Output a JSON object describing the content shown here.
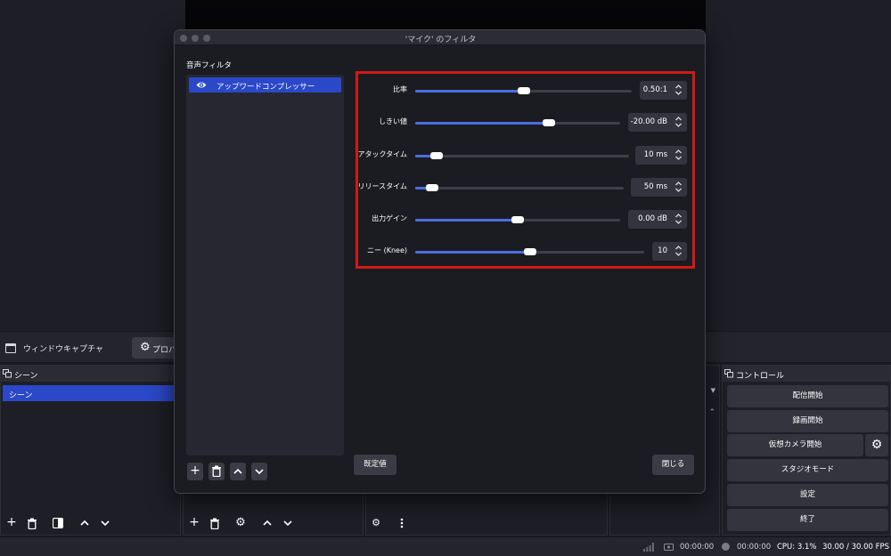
{
  "main": {
    "source_name": "ウィンドウキャプチャ",
    "properties_label": "プロパ",
    "scene_dock": {
      "title": "シーン",
      "items": [
        "シーン"
      ]
    },
    "controls_dock": {
      "title": "コントロール",
      "buttons": [
        "配信開始",
        "録画開始",
        "仮想カメラ開始",
        "スタジオモード",
        "設定",
        "終了"
      ]
    }
  },
  "status": {
    "rec_time": "00:00:00",
    "stream_time": "00:00:00",
    "cpu": "CPU: 3.1%",
    "fps": "30.00 / 30.00 FPS"
  },
  "dialog": {
    "title": "'マイク' のフィルタ",
    "audio_filters_heading": "音声フィルタ",
    "filters": [
      {
        "name": "アップワードコンプレッサー",
        "enabled": true
      }
    ],
    "params": [
      {
        "label": "比率",
        "value": "0.50:1",
        "level": 0.5
      },
      {
        "label": "しきい値",
        "value": "-20.00 dB",
        "level": 0.65
      },
      {
        "label": "アタックタイム",
        "value": "10 ms",
        "level": 0.1
      },
      {
        "label": "リリースタイム",
        "value": "50 ms",
        "level": 0.08
      },
      {
        "label": "出力ゲイン",
        "value": "0.00 dB",
        "level": 0.5
      },
      {
        "label": "ニー (Knee)",
        "value": "10",
        "level": 0.5
      }
    ],
    "defaults_button": "既定値",
    "close_button": "閉じる",
    "highlight_color": "#d11a14",
    "accent_color": "#2b48c9"
  }
}
